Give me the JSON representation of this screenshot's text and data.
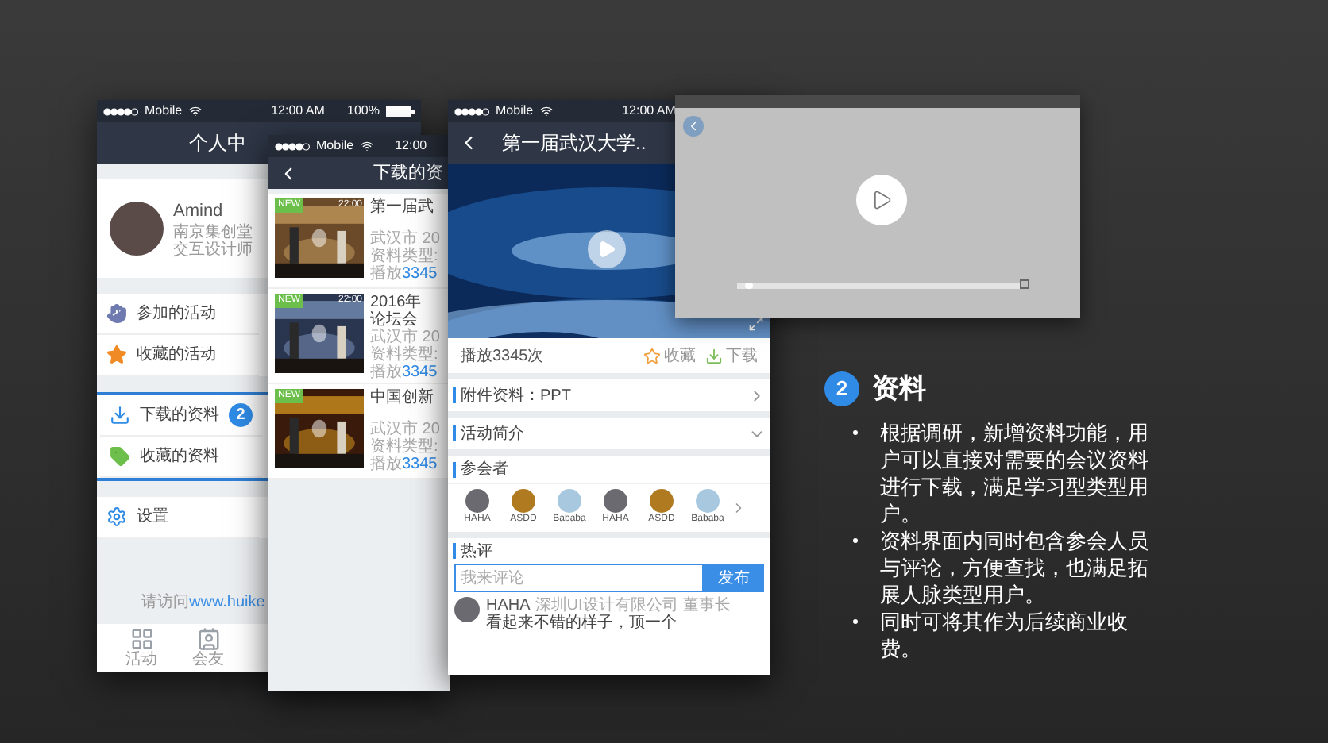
{
  "phone_profile": {
    "status": {
      "carrier": "Mobile",
      "time": "12:00 AM",
      "battery": "100%"
    },
    "title": "个人中",
    "user": {
      "name": "Amind",
      "company": "南京集创堂",
      "role": "交互设计师"
    },
    "menu_groups": [
      {
        "highlighted": false,
        "items": [
          {
            "label": "参加的活动",
            "kind": "hand"
          },
          {
            "label": "收藏的活动",
            "kind": "star"
          }
        ]
      },
      {
        "highlighted": true,
        "items": [
          {
            "label": "下载的资料",
            "kind": "download",
            "badge": "2"
          },
          {
            "label": "收藏的资料",
            "kind": "tag"
          }
        ]
      },
      {
        "highlighted": false,
        "items": [
          {
            "label": "设置",
            "kind": "gear"
          }
        ]
      }
    ],
    "footer": {
      "prefix": "请访问",
      "link": "www.huike"
    },
    "nav": [
      {
        "label": "活动",
        "kind": "grid"
      },
      {
        "label": "会友",
        "kind": "card"
      }
    ]
  },
  "phone_downloads": {
    "status": {
      "carrier": "Mobile",
      "time": "12:00"
    },
    "title": "下载的资",
    "items": [
      {
        "badge": "NEW",
        "duration": "22:00",
        "title": [
          "第一届武"
        ],
        "city": "武汉市 20",
        "type": "资料类型:",
        "plays_label": "播放",
        "plays": "3345"
      },
      {
        "badge": "NEW",
        "duration": "22:00",
        "title": [
          "2016年",
          "论坛会"
        ],
        "city": "武汉市 20",
        "type": "资料类型:",
        "plays_label": "播放",
        "plays": "3345"
      },
      {
        "badge": "NEW",
        "title": [
          "中国创新"
        ],
        "city": "武汉市 20",
        "type": "资料类型:",
        "plays_label": "播放",
        "plays": "3345"
      }
    ]
  },
  "phone_detail": {
    "status": {
      "carrier": "Mobile",
      "time": "12:00 AM"
    },
    "title": "第一届武汉大学..",
    "plays": "播放3345次",
    "actions": [
      {
        "label": "收藏",
        "kind": "star"
      },
      {
        "label": "下载",
        "kind": "download"
      }
    ],
    "sections": [
      {
        "label": "附件资料：PPT",
        "kind": "link"
      },
      {
        "label": "活动简介",
        "kind": "expander"
      }
    ],
    "attendees": {
      "title": "参会者",
      "people": [
        "HAHA",
        "ASDD",
        "Bababa",
        "HAHA",
        "ASDD",
        "Bababa"
      ]
    },
    "comments": {
      "title": "热评",
      "placeholder": "我来评论",
      "button": "发布",
      "items": [
        {
          "name": "HAHA",
          "company": "深圳UI设计有限公司",
          "position": "董事长",
          "text": "看起来不错的样子，顶一个"
        }
      ]
    }
  },
  "video_overlay": {
    "level": 0.03
  },
  "callout": {
    "number": "2",
    "title": "资料",
    "bullets": [
      "根据调研，新增资料功能，用户可以直接对需要的会议资料进行下载，满足学习型类型用户。",
      "资料界面内同时包含参会人员与评论，方便查找，也满足拓展人脉类型用户。",
      "同时可将其作为后续商业收费。"
    ]
  }
}
